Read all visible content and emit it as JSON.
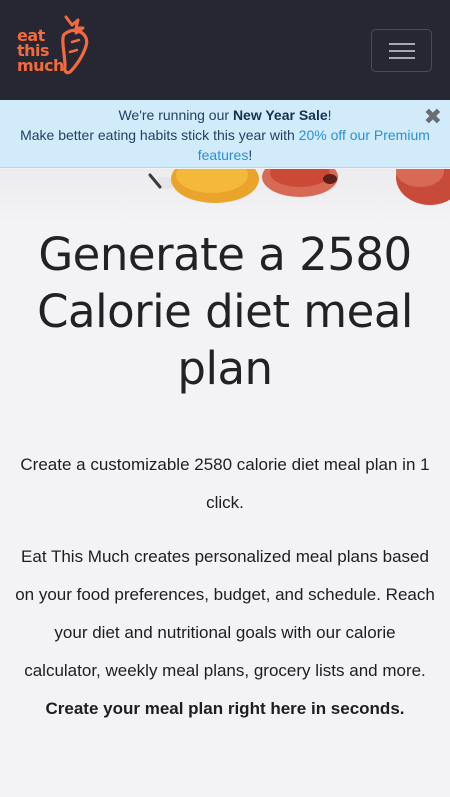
{
  "header": {
    "logo_lines": [
      "eat",
      "this",
      "much"
    ],
    "menu_icon": "hamburger-icon"
  },
  "banner": {
    "line1_prefix": "We're running our ",
    "line1_bold": "New Year Sale",
    "line1_suffix": "!",
    "line2_prefix": "Make better eating habits stick this year with ",
    "line2_link": "20% off our Premium features",
    "line2_suffix": "!",
    "close_icon": "close-icon"
  },
  "hero": {
    "headline": "Generate a 2580 Calorie diet meal plan",
    "intro": "Create a customizable 2580 calorie diet meal plan in 1 click.",
    "description": "Eat This Much creates personalized meal plans based on your food preferences, budget, and schedule. Reach your diet and nutritional goals with our calorie calculator, weekly meal plans, grocery lists and more.",
    "cta_bold": "Create your meal plan right here in seconds."
  },
  "colors": {
    "navbar": "#262733",
    "brand_orange": "#f26a3d",
    "banner_bg": "#d2ebfb",
    "link_blue": "#2b8fd6"
  }
}
